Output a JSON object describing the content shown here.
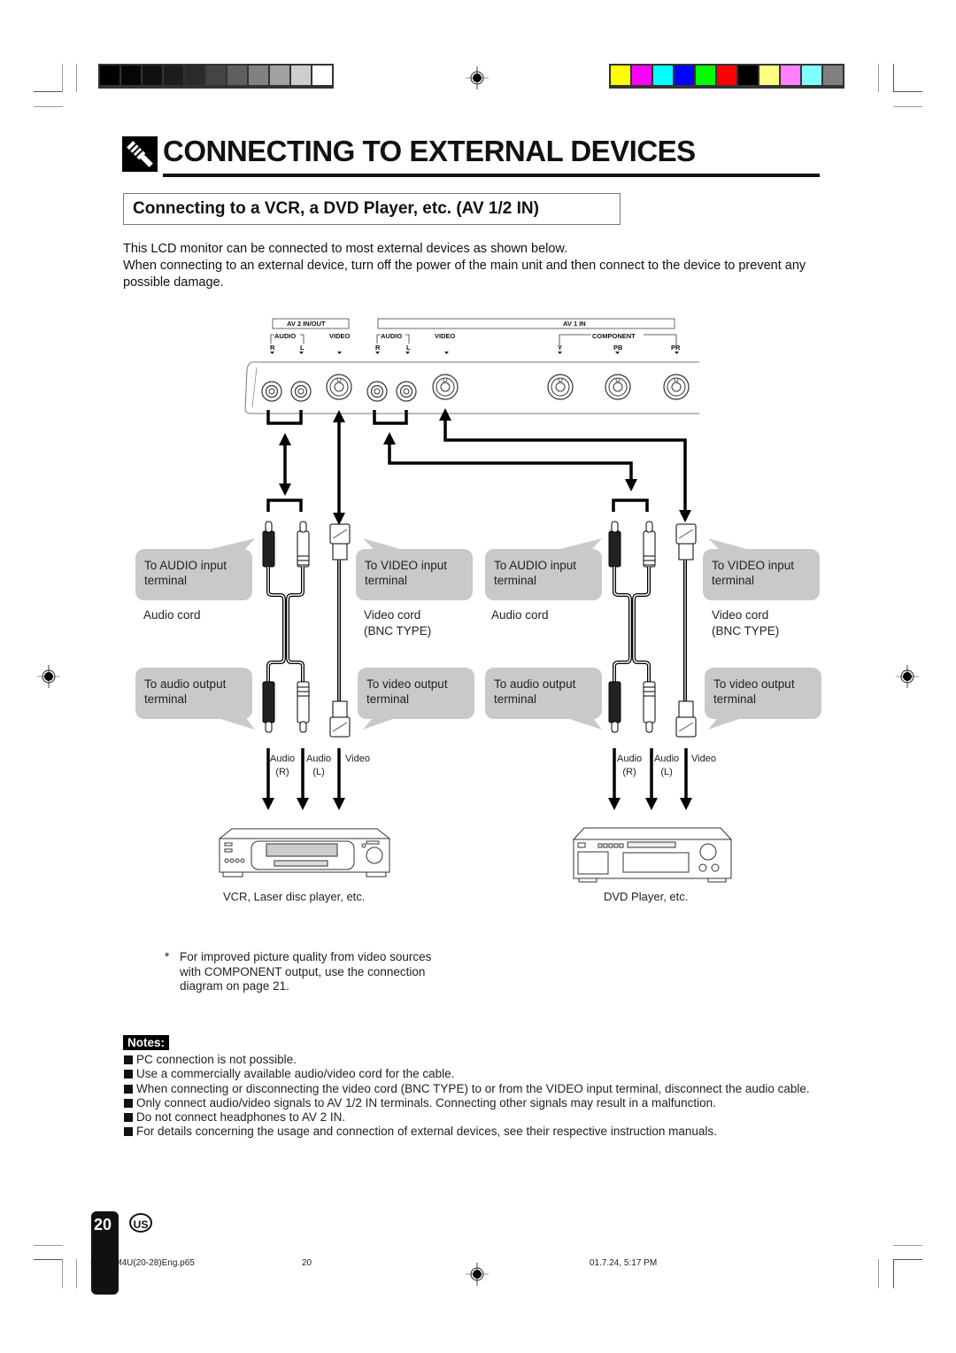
{
  "print_marks": {
    "grayscale_bar": [
      "#000000",
      "#060606",
      "#111111",
      "#1d1d1d",
      "#2a2a2a",
      "#444444",
      "#5f5f5f",
      "#818181",
      "#a1a1a1",
      "#cecece",
      "#ffffff"
    ],
    "color_bar": [
      "#ffff00",
      "#ff00ff",
      "#00ffff",
      "#0000ff",
      "#00ff00",
      "#ff0000",
      "#000000",
      "#ffff80",
      "#ff80ff",
      "#80ffff",
      "#808080"
    ]
  },
  "header": {
    "title": "CONNECTING TO EXTERNAL DEVICES",
    "section_title": "Connecting to a VCR, a DVD Player, etc. (AV 1/2 IN)"
  },
  "intro": [
    "This LCD monitor can be connected to most external devices as shown below.",
    "When connecting to an external device, turn off the power of the main unit and then connect to the device to prevent any possible damage."
  ],
  "panel": {
    "av2_label": "AV 2 IN/OUT",
    "av1_label": "AV 1 IN",
    "audio": "AUDIO",
    "video": "VIDEO",
    "component": "COMPONENT",
    "r": "R",
    "l": "L",
    "y": "Y",
    "pb": "PB",
    "pr": "PR"
  },
  "diagram": {
    "left": {
      "audio_in_bubble": "To AUDIO input terminal",
      "video_in_bubble": "To VIDEO input terminal",
      "audio_cord": "Audio cord",
      "video_cord_line1": "Video cord",
      "video_cord_line2": "(BNC TYPE)",
      "audio_out_bubble": "To audio output terminal",
      "video_out_bubble": "To video output terminal",
      "audio_r_line1": "Audio",
      "audio_r_line2": "(R)",
      "audio_l_line1": "Audio",
      "audio_l_line2": "(L)",
      "video": "Video",
      "device_caption": "VCR, Laser disc player, etc."
    },
    "right": {
      "audio_in_bubble": "To AUDIO input terminal",
      "video_in_bubble": "To VIDEO input terminal",
      "audio_cord": "Audio cord",
      "video_cord_line1": "Video cord",
      "video_cord_line2": "(BNC TYPE)",
      "audio_out_bubble": "To audio output terminal",
      "video_out_bubble": "To video output terminal",
      "audio_r_line1": "Audio",
      "audio_r_line2": "(R)",
      "audio_l_line1": "Audio",
      "audio_l_line2": "(L)",
      "video": "Video",
      "device_caption": "DVD Player, etc."
    }
  },
  "footnote": {
    "marker": "*",
    "text": "For improved picture quality from video sources with COMPONENT output, use the connection diagram on page 21."
  },
  "notes": {
    "label": "Notes:",
    "items": [
      "PC connection is not possible.",
      "Use a commercially available audio/video cord for the cable.",
      "When connecting or disconnecting the video cord (BNC TYPE) to or from the VIDEO input terminal, disconnect the audio cable.",
      "Only connect audio/video signals to AV 1/2 IN terminals. Connecting other signals may result in a malfunction.",
      "Do not connect headphones to AV 2 IN.",
      "For details concerning the usage and connection of external devices, see their respective instruction manuals."
    ]
  },
  "page": {
    "number": "20",
    "region": "US"
  },
  "footer": {
    "file": "LC-15M4U(20-28)Eng.p65",
    "page": "20",
    "timestamp": "01.7.24, 5:17 PM"
  }
}
